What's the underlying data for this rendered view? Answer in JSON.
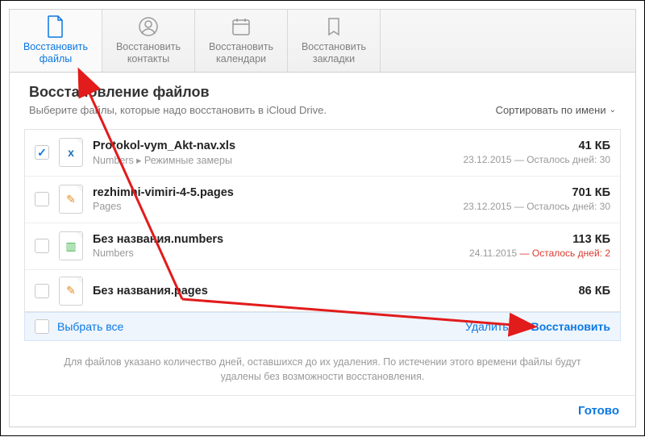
{
  "tabs": [
    {
      "l1": "Восстановить",
      "l2": "файлы"
    },
    {
      "l1": "Восстановить",
      "l2": "контакты"
    },
    {
      "l1": "Восстановить",
      "l2": "календари"
    },
    {
      "l1": "Восстановить",
      "l2": "закладки"
    }
  ],
  "header": {
    "title": "Восстановление файлов",
    "subtitle": "Выберите файлы, которые надо восстановить в iCloud Drive.",
    "sort": "Сортировать по имени"
  },
  "files": [
    {
      "name": "Protokol-vym_Akt-nav.xls",
      "loc": "Numbers ▸ Режимные замеры",
      "size": "41 КБ",
      "date": "23.12.2015",
      "rest": "— Осталось дней: 30",
      "warn": false,
      "checked": true,
      "glyph": "x",
      "gcolor": "#1f6fb8"
    },
    {
      "name": "rezhimni-vimiri-4-5.pages",
      "loc": "Pages",
      "size": "701 КБ",
      "date": "23.12.2015",
      "rest": "— Осталось дней: 30",
      "warn": false,
      "checked": false,
      "glyph": "✎",
      "gcolor": "#e58a1f"
    },
    {
      "name": "Без названия.numbers",
      "loc": "Numbers",
      "size": "113 КБ",
      "date": "24.11.2015",
      "rest": "— Осталось дней: 2",
      "warn": true,
      "checked": false,
      "glyph": "◫",
      "gcolor": "#3eb64a"
    },
    {
      "name": "Без названия.pages",
      "loc": "",
      "size": "86 КБ",
      "date": "",
      "rest": "",
      "warn": false,
      "checked": false,
      "glyph": "✎",
      "gcolor": "#e58a1f"
    }
  ],
  "actions": {
    "selectAll": "Выбрать все",
    "delete": "Удалить",
    "restore": "Восстановить"
  },
  "note": "Для файлов указано количество дней, оставшихся до их удаления. По истечении этого времени файлы будут удалены без возможности восстановления.",
  "footer": {
    "done": "Готово"
  }
}
